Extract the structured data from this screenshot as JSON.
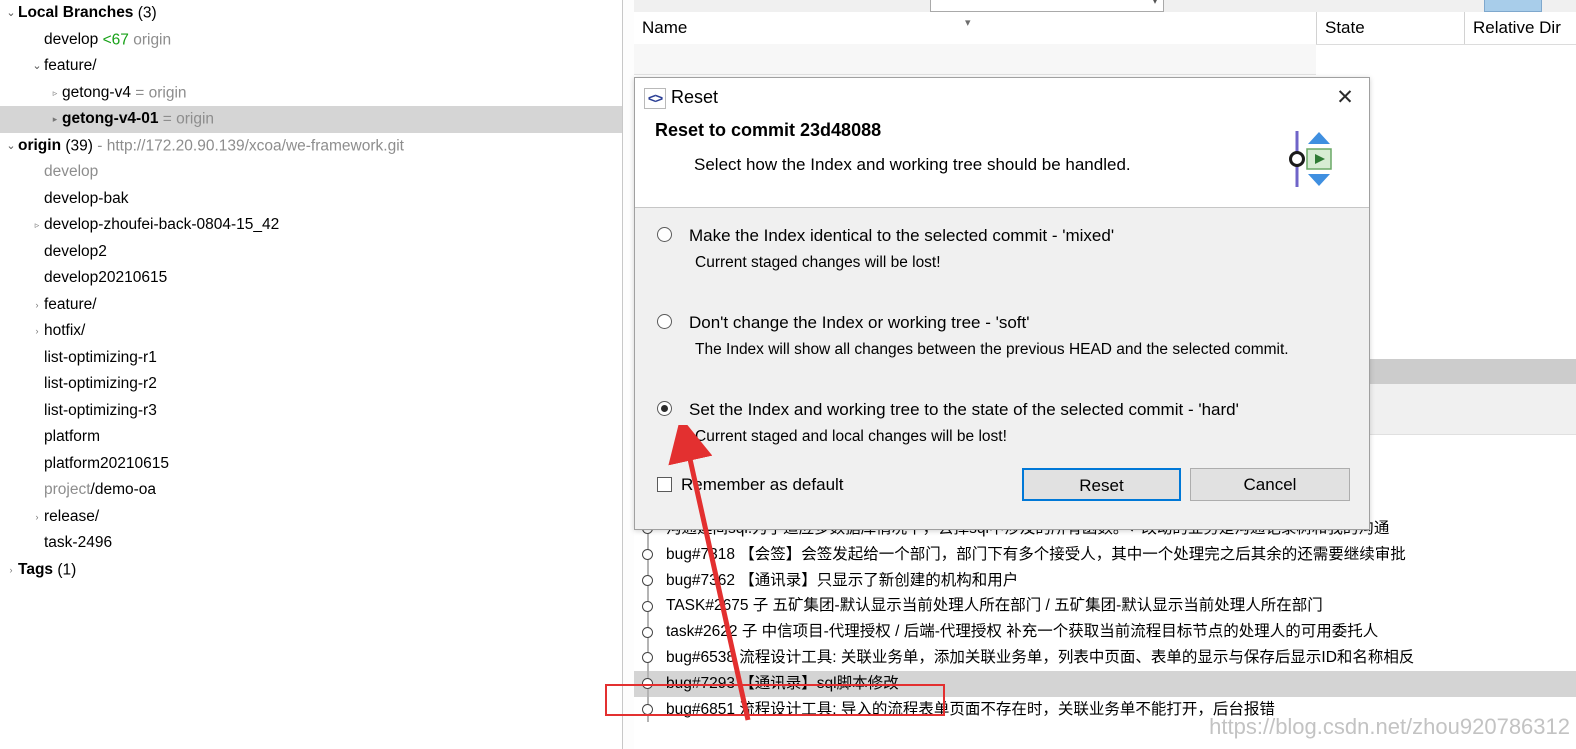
{
  "tree": {
    "rows": [
      {
        "indent": 0,
        "twisty": "v",
        "label": "Local Branches",
        "suffix": " (3)",
        "bold": true,
        "selected": false
      },
      {
        "indent": 1,
        "twisty": "",
        "label": "develop",
        "green": " <67",
        "muted": " origin",
        "bold": false,
        "selected": false
      },
      {
        "indent": 1,
        "twisty": "v",
        "label": "feature/",
        "bold": false,
        "selected": false
      },
      {
        "indent": 2,
        "twisty": "r-open",
        "label": "getong-v4",
        "muted": " = origin",
        "bold": false,
        "selected": false
      },
      {
        "indent": 2,
        "twisty": "r-solid",
        "label": "getong-v4-01",
        "muted": " = origin",
        "bold": true,
        "selected": true
      },
      {
        "indent": 0,
        "twisty": "v",
        "label": "origin",
        "suffix": " (39)",
        "mutedurl": " - http://172.20.90.139/xcoa/we-framework.git",
        "bold": true,
        "selected": false
      },
      {
        "indent": 1,
        "twisty": "",
        "label": "develop",
        "dim": true,
        "selected": false
      },
      {
        "indent": 1,
        "twisty": "",
        "label": "develop-bak",
        "selected": false
      },
      {
        "indent": 1,
        "twisty": "r-open",
        "label": "develop-zhoufei-back-0804-15_42",
        "selected": false
      },
      {
        "indent": 1,
        "twisty": "",
        "label": "develop2",
        "selected": false
      },
      {
        "indent": 1,
        "twisty": "",
        "label": "develop20210615",
        "selected": false
      },
      {
        "indent": 1,
        "twisty": ">",
        "label": "feature/",
        "selected": false
      },
      {
        "indent": 1,
        "twisty": ">",
        "label": "hotfix/",
        "selected": false
      },
      {
        "indent": 1,
        "twisty": "",
        "label": "list-optimizing-r1",
        "selected": false
      },
      {
        "indent": 1,
        "twisty": "",
        "label": "list-optimizing-r2",
        "selected": false
      },
      {
        "indent": 1,
        "twisty": "",
        "label": "list-optimizing-r3",
        "selected": false
      },
      {
        "indent": 1,
        "twisty": "",
        "label": "platform",
        "selected": false
      },
      {
        "indent": 1,
        "twisty": "",
        "label": "platform20210615",
        "selected": false
      },
      {
        "indent": 1,
        "twisty": "",
        "label": "project/demo-oa",
        "prefixdim": "project",
        "selected": false
      },
      {
        "indent": 1,
        "twisty": ">",
        "label": "release/",
        "selected": false
      },
      {
        "indent": 1,
        "twisty": "",
        "label": "task-2496",
        "selected": false
      },
      {
        "indent": 0,
        "twisty": ">",
        "label": "Tags",
        "suffix": " (1)",
        "bold": true,
        "selected": false
      }
    ]
  },
  "table": {
    "columns": {
      "name": "Name",
      "state": "State",
      "relative_dir": "Relative Dir"
    }
  },
  "dialog": {
    "icon": "code-brackets-icon",
    "title": "Reset",
    "close_label": "✕",
    "heading": "Reset to commit 23d48088",
    "subheading": "Select how the Index and working tree should be handled.",
    "options": [
      {
        "id": "mixed",
        "label": "Make the Index identical to the selected commit - 'mixed'",
        "note": "Current staged changes will be lost!",
        "selected": false
      },
      {
        "id": "soft",
        "label": "Don't change the Index or working tree - 'soft'",
        "note": "The Index will show all changes between the previous HEAD and the selected commit.",
        "selected": false
      },
      {
        "id": "hard",
        "label": "Set the Index and working tree to the state of the selected commit - 'hard'",
        "note": "Current staged and local changes will be lost!",
        "selected": true
      }
    ],
    "remember_label": "Remember as default",
    "remember_checked": false,
    "buttons": {
      "primary": "Reset",
      "secondary": "Cancel"
    },
    "focus_color": "#0078d7"
  },
  "commits": [
    {
      "msg": "沟通建间sql:为了适应多数据库情况下，去掉sql中涉及的所有函数。↵改动的业务是沟通记录树和我的沟通",
      "selected": false
    },
    {
      "msg": "bug#7318 【会签】会签发起给一个部门，部门下有多个接受人，其中一个处理完之后其余的还需要继续审批",
      "selected": false
    },
    {
      "msg": "bug#7362 【通讯录】只显示了新创建的机构和用户",
      "selected": false
    },
    {
      "msg": "TASK#2675 子 五矿集团-默认显示当前处理人所在部门 / 五矿集团-默认显示当前处理人所在部门",
      "selected": false
    },
    {
      "msg": "task#2622 子 中信项目-代理授权 / 后端-代理授权  补充一个获取当前流程目标节点的处理人的可用委托人",
      "selected": false
    },
    {
      "msg": "bug#6538 流程设计工具: 关联业务单，添加关联业务单，列表中页面、表单的显示与保存后显示ID和名称相反",
      "selected": false
    },
    {
      "msg": "bug#7293 【通讯录】sql脚本修改",
      "selected": true
    },
    {
      "msg": "bug#6851 流程设计工具: 导入的流程表单页面不存在时，关联业务单不能打开，后台报错",
      "selected": false
    }
  ],
  "annotations": {
    "watermark": "https://blog.csdn.net/zhou920786312",
    "highlight_color": "#e33030"
  }
}
